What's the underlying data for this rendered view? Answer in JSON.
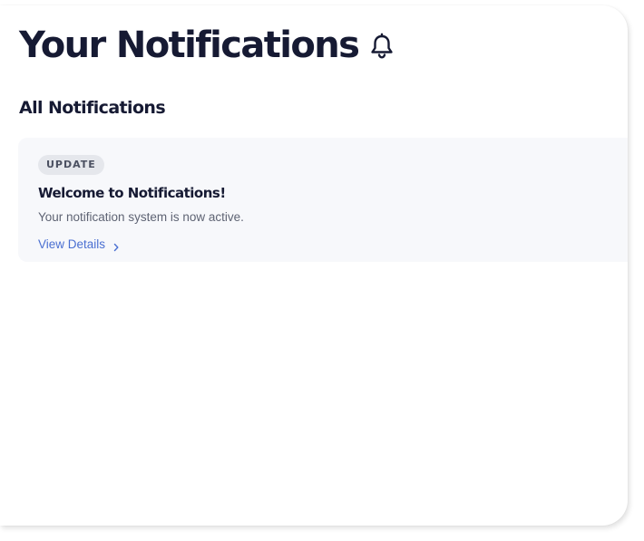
{
  "header": {
    "title": "Your Notifications",
    "icon": "bell-icon"
  },
  "section": {
    "title": "All Notifications"
  },
  "notifications": [
    {
      "badge": "UPDATE",
      "title": "Welcome to Notifications!",
      "description": "Your notification system is now active.",
      "link_label": "View Details",
      "link_icon": "chevron-right-icon"
    }
  ],
  "colors": {
    "heading": "#161a33",
    "link": "#4a6fd1",
    "card_background": "#f7f8fb",
    "badge_background": "#e5e7ec"
  }
}
